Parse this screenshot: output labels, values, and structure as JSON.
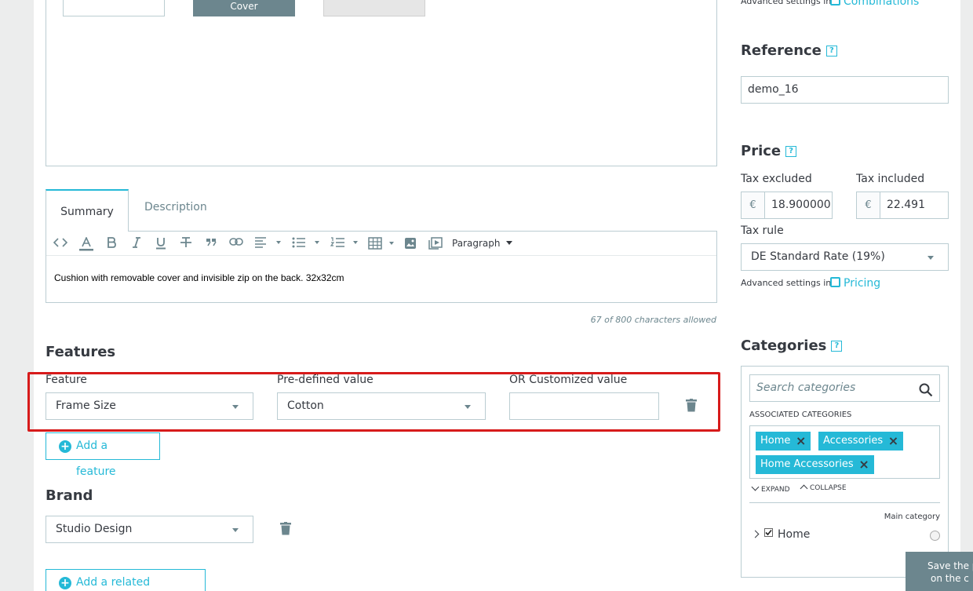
{
  "images": {
    "cover_label": "Cover"
  },
  "tabs": [
    {
      "label": "Summary"
    },
    {
      "label": "Description"
    }
  ],
  "editor": {
    "paragraph_label": "Paragraph",
    "content": "Cushion with removable cover and invisible zip on the back. 32x32cm",
    "char_count": "67 of 800 characters allowed"
  },
  "features": {
    "title": "Features",
    "feature_label": "Feature",
    "feature_value": "Frame Size",
    "predefined_label": "Pre-defined value",
    "predefined_value": "Cotton",
    "customized_label": "OR Customized value",
    "customized_value": "",
    "add_label": "Add a feature"
  },
  "brand": {
    "title": "Brand",
    "value": "Studio Design",
    "add_related_label": "Add a related product"
  },
  "sidebar": {
    "advanced_top_text": "Advanced settings in",
    "combinations_link": "Combinations",
    "reference_title": "Reference",
    "reference_value": "demo_16",
    "price_title": "Price",
    "tax_excluded_label": "Tax excluded",
    "tax_included_label": "Tax included",
    "currency_symbol": "€",
    "tax_excluded_value": "18.900000",
    "tax_included_value": "22.491",
    "tax_rule_label": "Tax rule",
    "tax_rule_value": "DE Standard Rate (19%)",
    "advanced_pricing_text": "Advanced settings in",
    "pricing_link": "Pricing",
    "help_mark": "?",
    "categories_title": "Categories",
    "search_placeholder": "Search categories",
    "associated_label": "ASSOCIATED CATEGORIES",
    "tags": [
      "Home",
      "Accessories",
      "Home Accessories"
    ],
    "expand_label": "EXPAND",
    "collapse_label": "COLLAPSE",
    "main_category_label": "Main category",
    "tree_item": "Home",
    "save_line1": "Save the p",
    "save_line2": "on the c"
  },
  "colors": {
    "accent": "#25b9d7",
    "highlight": "#d71b1b",
    "border": "#bbcdd2"
  }
}
